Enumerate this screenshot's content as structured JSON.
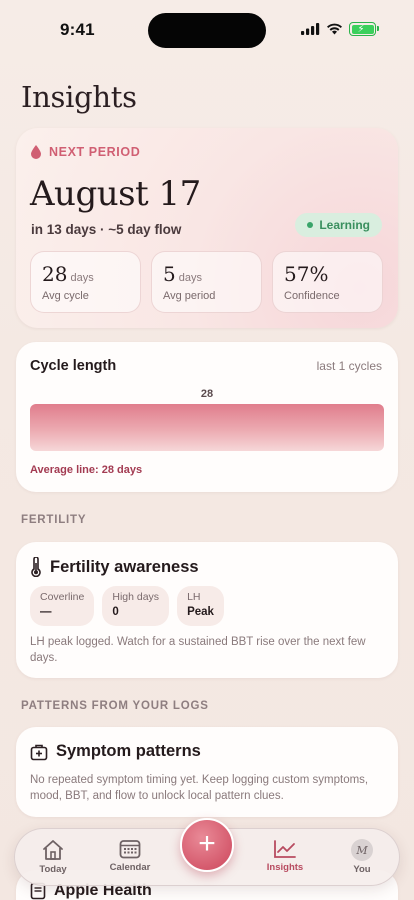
{
  "status_bar": {
    "time": "9:41"
  },
  "page_title": "Insights",
  "next_period": {
    "label": "NEXT PERIOD",
    "date": "August 17",
    "subtitle": "in 13 days · ~5 day flow",
    "badge": "Learning",
    "stats": [
      {
        "value": "28",
        "unit": "days",
        "label": "Avg cycle"
      },
      {
        "value": "5",
        "unit": "days",
        "label": "Avg period"
      },
      {
        "value": "57%",
        "unit": "",
        "label": "Confidence"
      }
    ]
  },
  "cycle_length": {
    "title": "Cycle length",
    "range": "last 1 cycles",
    "bar_value": "28",
    "average_text": "Average line: 28 days"
  },
  "chart_data": {
    "type": "bar",
    "categories": [
      ""
    ],
    "values": [
      28
    ],
    "title": "Cycle length",
    "xlabel": "",
    "ylabel": ""
  },
  "sections": {
    "fertility": "FERTILITY",
    "patterns": "PATTERNS FROM YOUR LOGS"
  },
  "fertility": {
    "title": "Fertility awareness",
    "chips": [
      {
        "label": "Coverline",
        "value": "—"
      },
      {
        "label": "High days",
        "value": "0"
      },
      {
        "label": "LH",
        "value": "Peak"
      }
    ],
    "note": "LH peak logged. Watch for a sustained BBT rise over the next few days."
  },
  "symptoms": {
    "title": "Symptom patterns",
    "note": "No repeated symptom timing yet. Keep logging custom symptoms, mood, BBT, and flow to unlock local pattern clues."
  },
  "health": {
    "title": "Apple Health"
  },
  "tabs": {
    "today": "Today",
    "calendar": "Calendar",
    "insights": "Insights",
    "you": "You",
    "avatar_initial": "M",
    "add": "+"
  },
  "colors": {
    "accent": "#d05f73",
    "learning": "#3a8f5e",
    "bar_top": "#e07d8c"
  }
}
